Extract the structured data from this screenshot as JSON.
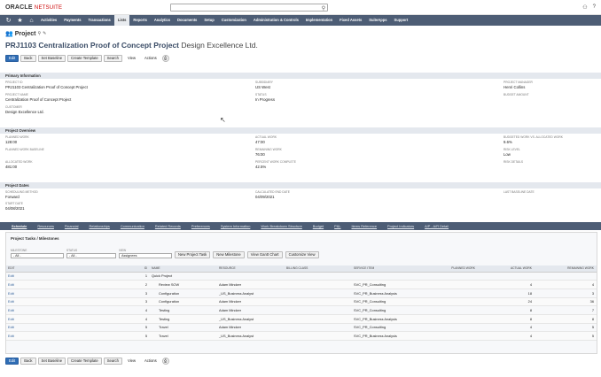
{
  "brand": {
    "name": "ORACLE",
    "suffix": "NETSUITE"
  },
  "nav": [
    "Activities",
    "Payments",
    "Transactions",
    "Lists",
    "Reports",
    "Analytics",
    "Documents",
    "Setup",
    "Customization",
    "Administration & Controls",
    "Implementation",
    "Fixed Assets",
    "SuiteApps",
    "Support"
  ],
  "page": {
    "type_label": "Project",
    "project_number": "PRJ1103 Centralization Proof of Concept Project",
    "customer": "Design Excellence Ltd."
  },
  "buttons": {
    "edit": "Edit",
    "back": "Back",
    "set_baseline": "Set Baseline",
    "create_template": "Create Template",
    "search": "Search",
    "view": "View",
    "actions": "Actions"
  },
  "primary": {
    "title": "Primary Information",
    "project_id_label": "Project ID",
    "project_id": "PRJ1103 Centralization Proof of Concept Project",
    "project_name_label": "Project Name",
    "project_name": "Centralization Proof of Concept Project",
    "customer_label": "Customer",
    "customer": "Design Excellence Ltd.",
    "subsidiary_label": "Subsidiary",
    "subsidiary": "US West",
    "status_label": "Status",
    "status": "In Progress",
    "manager_label": "Project Manager",
    "manager": "Henri Collins",
    "budget_label": "Budget Amount",
    "budget": ""
  },
  "overview": {
    "title": "Project Overview",
    "planned_work_label": "Planned Work",
    "planned_work": "128:00",
    "baseline_label": "Planned Work Baseline",
    "baseline": "",
    "allocated_label": "Allocated Work",
    "allocated": "481:00",
    "actual_label": "Actual Work",
    "actual": "47:00",
    "remaining_label": "Remaining Work",
    "remaining": "76:00",
    "pct_label": "Percent Work Complete",
    "pct": "42.5%",
    "budgeted_label": "Budgeted Work vs. Allocated Work",
    "budgeted": "9.6%",
    "risk_label": "Risk Level",
    "risk": "Low",
    "risk_details_label": "Risk Details",
    "risk_details": ""
  },
  "dates": {
    "title": "Project Dates",
    "sched_label": "Scheduling Method",
    "sched": "Forward",
    "start_label": "Start Date",
    "start": "04/08/2021",
    "end_label": "Calculated End Date",
    "end": "04/09/2021",
    "baseline_end_label": "Last Baseline Date",
    "baseline_end": ""
  },
  "tabs": [
    "Schedule",
    "Resources",
    "Financial",
    "Relationships",
    "Communication",
    "Related Records",
    "Preferences",
    "System Information",
    "Work Breakdown Structure",
    "Budget",
    "P&L",
    "Items Reference",
    "Project Indicators",
    "A/P - A/R Detail"
  ],
  "tasks": {
    "title": "Project Tasks / Milestones",
    "filters": [
      {
        "label": "MILESTONE",
        "value": "- All -"
      },
      {
        "label": "STATUS",
        "value": "- All -"
      },
      {
        "label": "VIEW",
        "value": "Assignees"
      }
    ],
    "new_task": "New Project Task",
    "new_milestone": "New Milestone",
    "gantt": "View Gantt Chart",
    "customize": "Customize View",
    "columns": [
      "EDIT",
      "ID",
      "NAME",
      "RESOURCE",
      "BILLING CLASS",
      "SERVICE ITEM",
      "PLANNED WORK",
      "ACTUAL WORK",
      "REMAINING WORK"
    ],
    "rows": [
      [
        "Edit",
        "1",
        "Quick Project",
        "",
        "",
        "",
        "",
        "",
        ""
      ],
      [
        "Edit",
        "2",
        "Review SOW",
        "Adam Mindzer",
        "",
        "SVC_PR_Consulting",
        "",
        "4",
        "4"
      ],
      [
        "Edit",
        "3",
        "Configuration",
        "_US_Business Analyst",
        "",
        "SVC_PR_Business Analysis",
        "",
        "18",
        "3"
      ],
      [
        "Edit",
        "3",
        "Configuration",
        "Adam Mindzer",
        "",
        "SVC_PR_Consulting",
        "",
        "24",
        "36"
      ],
      [
        "Edit",
        "4",
        "Testing",
        "Adam Mindzer",
        "",
        "SVC_PR_Consulting",
        "",
        "8",
        "7"
      ],
      [
        "Edit",
        "4",
        "Testing",
        "_US_Business Analyst",
        "",
        "SVC_PR_Business Analysis",
        "",
        "8",
        "8"
      ],
      [
        "Edit",
        "5",
        "Travel",
        "Adam Mindzer",
        "",
        "SVC_PR_Consulting",
        "",
        "4",
        "5"
      ],
      [
        "Edit",
        "5",
        "Travel",
        "_US_Business Analyst",
        "",
        "SVC_PR_Business Analysis",
        "",
        "4",
        "5"
      ]
    ]
  }
}
